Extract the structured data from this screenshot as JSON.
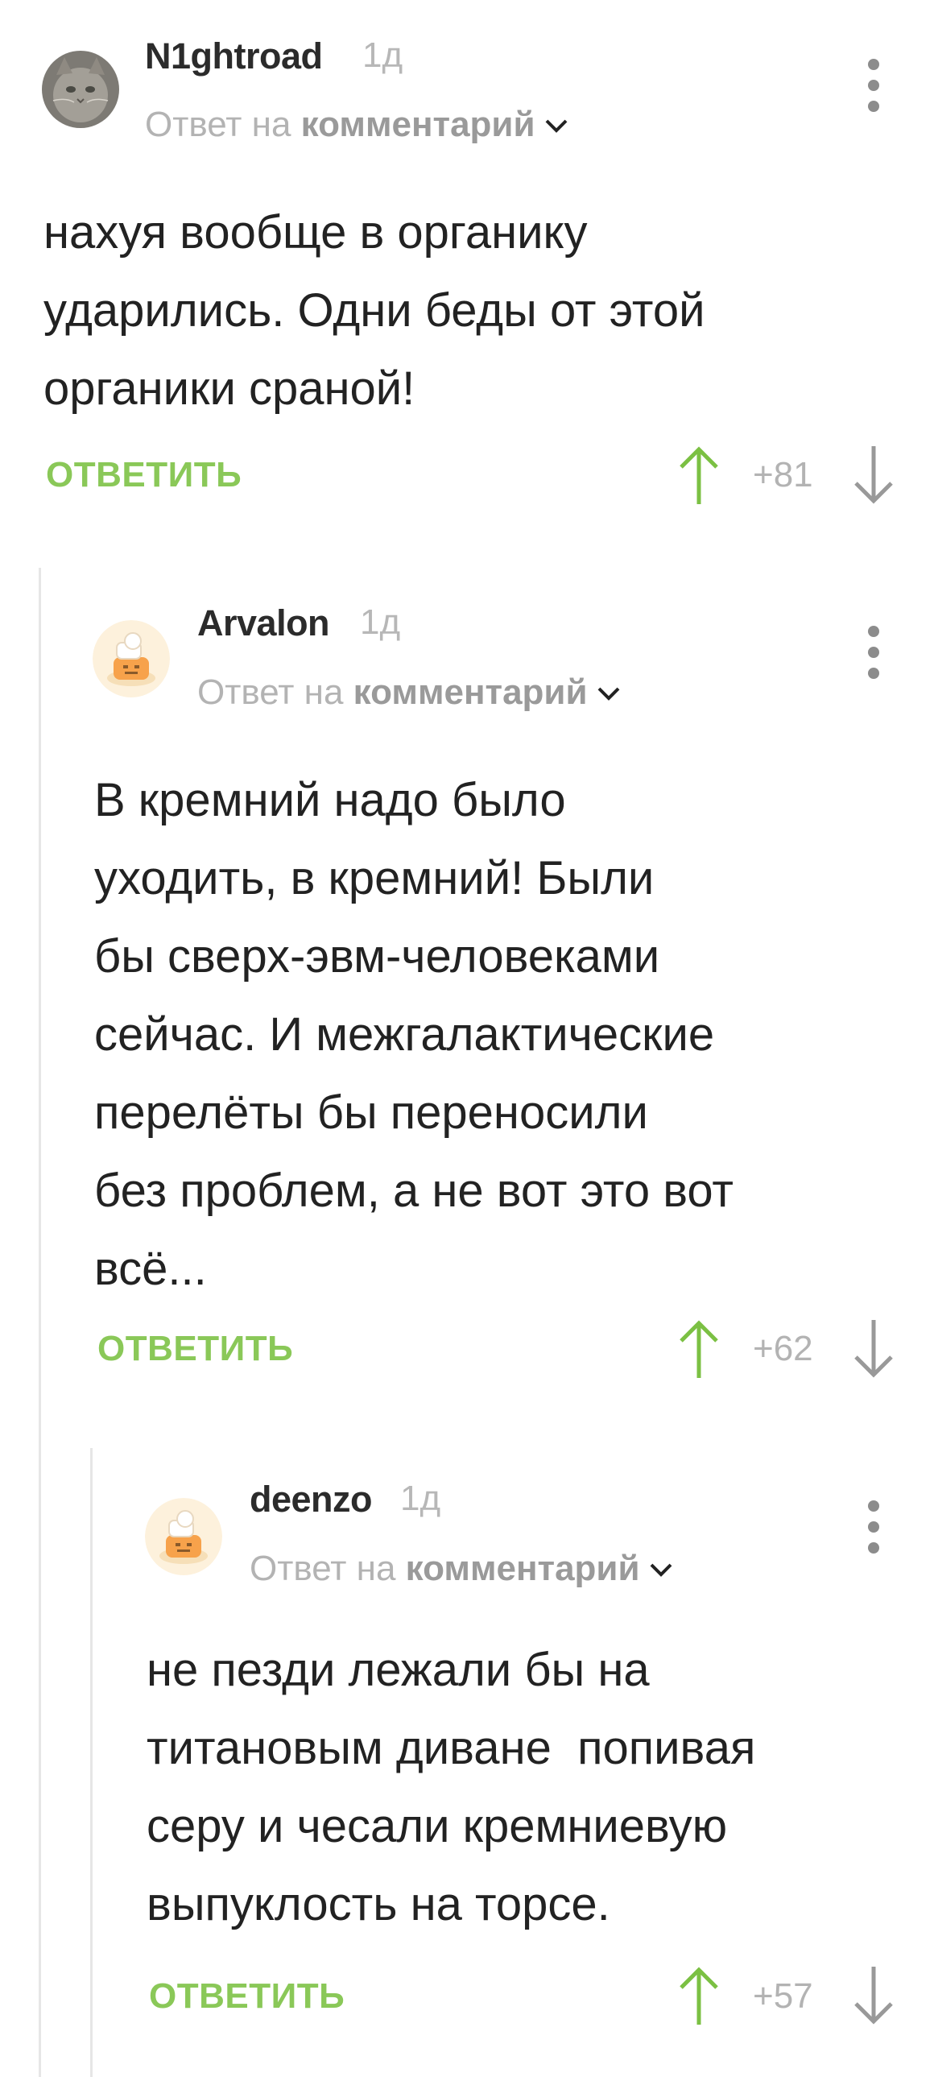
{
  "comments": [
    {
      "username": "N1ghtroad",
      "time": "1д",
      "reply_prefix": "Ответ на",
      "reply_target": "комментарий",
      "text": "нахуя вообще в органику\nударились. Одни беды от этой\nорганики сраной!",
      "reply_label": "ОТВЕТИТЬ",
      "votes": "+81",
      "avatar": "cat-photo"
    },
    {
      "username": "Arvalon",
      "time": "1д",
      "reply_prefix": "Ответ на",
      "reply_target": "комментарий",
      "text": "В кремний надо было\nуходить, в кремний! Были\nбы сверх-эвм-человеками\nсейчас. И межгалактические\nперелёты бы переносили\nбез проблем, а не вот это вот\nвсё...",
      "reply_label": "ОТВЕТИТЬ",
      "votes": "+62",
      "avatar": "default-chef-avatar"
    },
    {
      "username": "deenzo",
      "time": "1д",
      "reply_prefix": "Ответ на",
      "reply_target": "комментарий",
      "text": "не пезди лежали бы на\nтитановым диване  попивая\nсеру и чесали кремниевую\nвыпуклость на торсе.",
      "reply_label": "ОТВЕТИТЬ",
      "votes": "+57",
      "avatar": "default-chef-avatar"
    }
  ],
  "colors": {
    "accent_green": "#8ac858",
    "text_dark": "#222222",
    "text_muted": "#b3b3b3",
    "thread_line": "#e6e6e6"
  }
}
